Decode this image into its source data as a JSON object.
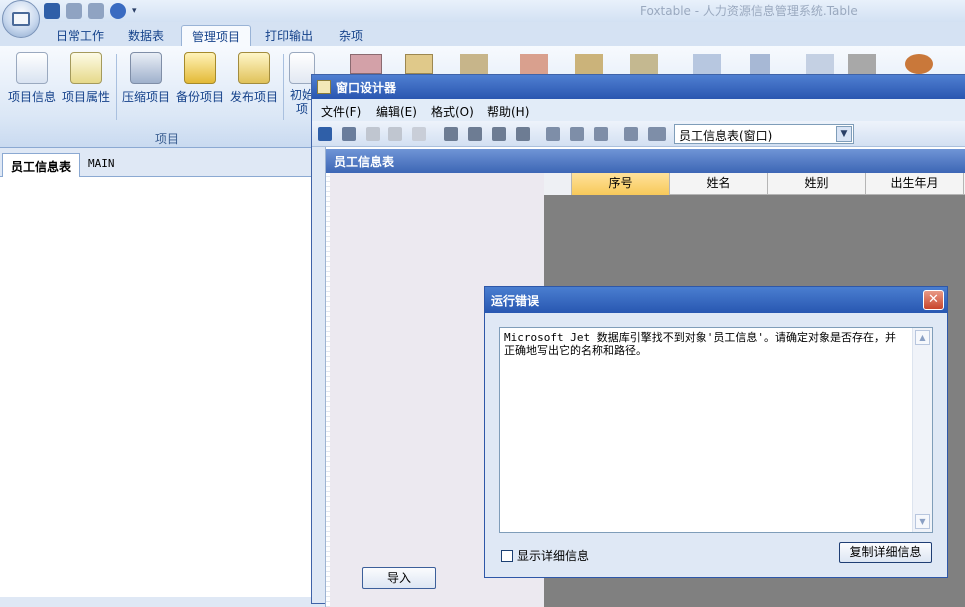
{
  "app": {
    "title": "Foxtable - 人力资源信息管理系统.Table",
    "quick_access": [
      {
        "icon": "save-icon"
      },
      {
        "icon": "undo-icon"
      },
      {
        "icon": "redo-icon"
      },
      {
        "icon": "help-icon"
      },
      {
        "icon": "customize-arrow-icon"
      }
    ]
  },
  "ribbon": {
    "tabs": [
      "日常工作",
      "数据表",
      "管理项目",
      "打印输出",
      "杂项"
    ],
    "active_tab": "管理项目",
    "buttons": [
      "项目信息",
      "项目属性",
      "压缩项目",
      "备份项目",
      "发布项目",
      "初始",
      "项"
    ],
    "group_label": "项目"
  },
  "left_panel": {
    "tabs": [
      "员工信息表",
      "MAIN"
    ]
  },
  "designer": {
    "title": "窗口设计器",
    "menu": [
      "文件(F)",
      "编辑(E)",
      "格式(O)",
      "帮助(H)"
    ],
    "object_select": "员工信息表(窗口)",
    "form": {
      "caption": "员工信息表",
      "columns": [
        "序号",
        "姓名",
        "姓别",
        "出生年月"
      ],
      "import_button": "导入"
    }
  },
  "error_dialog": {
    "title": "运行错误",
    "message": "Microsoft Jet 数据库引擎找不到对象'员工信息'。请确定对象是否存在，并\n正确地写出它的名称和路径。",
    "show_details": "显示详细信息",
    "copy_details": "复制详细信息",
    "close": "✕"
  }
}
